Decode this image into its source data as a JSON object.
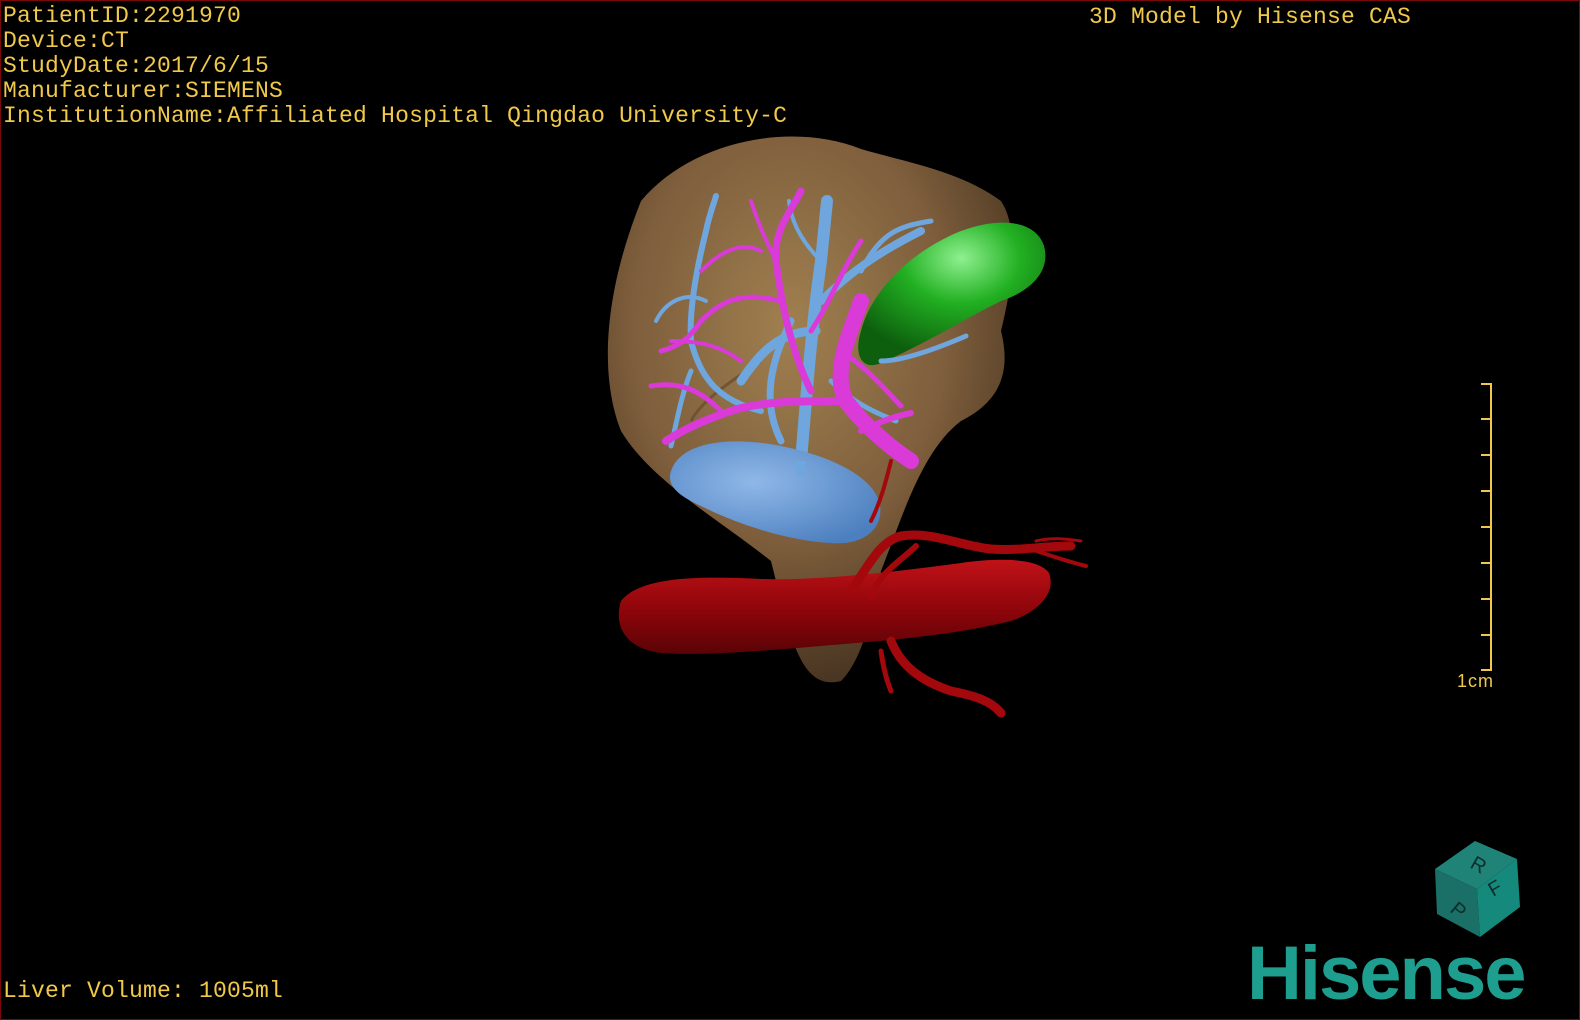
{
  "patient_info": {
    "patient_id": "PatientID:2291970",
    "device": "Device:CT",
    "study_date": "StudyDate:2017/6/15",
    "manufacturer": "Manufacturer:SIEMENS",
    "institution": "InstitutionName:Affiliated Hospital Qingdao University-C"
  },
  "model_credit": "3D Model by Hisense CAS",
  "liver_volume": "Liver Volume: 1005ml",
  "scale": {
    "label": "1cm"
  },
  "orientation_cube": {
    "labels": [
      "R",
      "F",
      "P"
    ]
  },
  "brand": "Hisense",
  "colors": {
    "overlay_text": "#f0c94a",
    "liver": "#8a6a45",
    "hepatic_vein": "#6fa6de",
    "portal_vein": "#d93ad8",
    "gallbladder": "#2fb32f",
    "artery": "#a3080d",
    "brand": "#1e9e8e"
  }
}
